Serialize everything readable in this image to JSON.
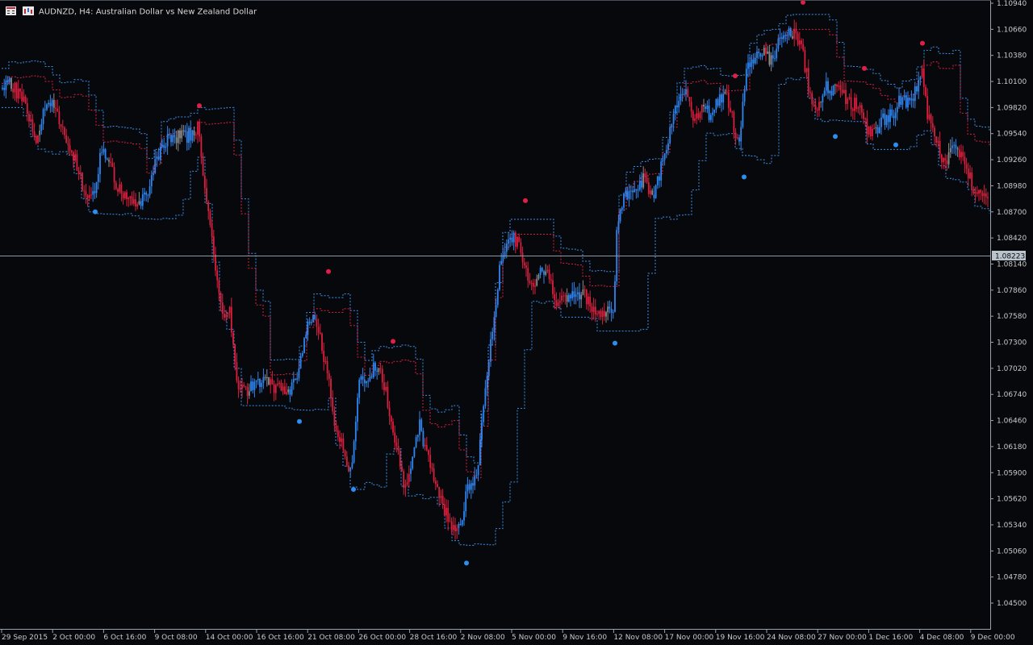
{
  "header": {
    "symbol": "AUDNZD",
    "timeframe": "H4:",
    "description": "Australian Dollar vs New Zealand Dollar"
  },
  "colors": {
    "background": "#07080c",
    "bull": "#2f86f0",
    "bear": "#d8203e",
    "neutral": "#8c8c8c",
    "band_upper": "#3b8fe8",
    "band_lower": "#d8203e",
    "crosshair": "#8a9aa6",
    "price_label_bg": "#b9c3cc"
  },
  "price_marker": "1.08223",
  "chart_data": {
    "type": "candlestick",
    "ylim": [
      1.0437,
      1.1102
    ],
    "y_ticks": [
      "1.10940",
      "1.10660",
      "1.10380",
      "1.10100",
      "1.09820",
      "1.09540",
      "1.09260",
      "1.08980",
      "1.08700",
      "1.08420",
      "1.08140",
      "1.07860",
      "1.07580",
      "1.07300",
      "1.07020",
      "1.06740",
      "1.06460",
      "1.06180",
      "1.05900",
      "1.05620",
      "1.05340",
      "1.05060",
      "1.04780",
      "1.04500"
    ],
    "x_ticks": [
      "29 Sep 2015",
      "2 Oct 00:00",
      "6 Oct 16:00",
      "9 Oct 08:00",
      "14 Oct 00:00",
      "16 Oct 16:00",
      "21 Oct 08:00",
      "26 Oct 00:00",
      "28 Oct 16:00",
      "2 Nov 08:00",
      "5 Nov 00:00",
      "9 Nov 16:00",
      "12 Nov 08:00",
      "17 Nov 00:00",
      "19 Nov 16:00",
      "24 Nov 08:00",
      "27 Nov 00:00",
      "1 Dec 16:00",
      "4 Dec 08:00",
      "9 Dec 00:00"
    ],
    "path": [
      [
        0,
        1.1
      ],
      [
        10,
        1.101
      ],
      [
        30,
        1.099
      ],
      [
        45,
        1.095
      ],
      [
        60,
        1.099
      ],
      [
        75,
        1.0965
      ],
      [
        90,
        1.0935
      ],
      [
        105,
        1.089
      ],
      [
        118,
        1.0885
      ],
      [
        125,
        1.094
      ],
      [
        135,
        1.093
      ],
      [
        145,
        1.0895
      ],
      [
        160,
        1.0885
      ],
      [
        175,
        1.088
      ],
      [
        185,
        1.0895
      ],
      [
        200,
        1.0945
      ],
      [
        215,
        1.095
      ],
      [
        230,
        1.095
      ],
      [
        245,
        1.096
      ],
      [
        255,
        1.089
      ],
      [
        265,
        1.082
      ],
      [
        275,
        1.0765
      ],
      [
        285,
        1.076
      ],
      [
        295,
        1.068
      ],
      [
        310,
        1.068
      ],
      [
        325,
        1.069
      ],
      [
        345,
        1.068
      ],
      [
        360,
        1.0675
      ],
      [
        370,
        1.07
      ],
      [
        385,
        1.076
      ],
      [
        395,
        1.074
      ],
      [
        405,
        1.07
      ],
      [
        415,
        1.064
      ],
      [
        425,
        1.0615
      ],
      [
        435,
        1.059
      ],
      [
        445,
        1.0685
      ],
      [
        455,
        1.069
      ],
      [
        465,
        1.0705
      ],
      [
        475,
        1.069
      ],
      [
        490,
        1.0625
      ],
      [
        500,
        1.058
      ],
      [
        510,
        1.0595
      ],
      [
        520,
        1.064
      ],
      [
        530,
        1.0605
      ],
      [
        540,
        1.058
      ],
      [
        550,
        1.055
      ],
      [
        560,
        1.0535
      ],
      [
        570,
        1.053
      ],
      [
        580,
        1.0575
      ],
      [
        590,
        1.058
      ],
      [
        600,
        1.067
      ],
      [
        610,
        1.074
      ],
      [
        620,
        1.082
      ],
      [
        630,
        1.084
      ],
      [
        640,
        1.084
      ],
      [
        650,
        1.081
      ],
      [
        660,
        1.079
      ],
      [
        670,
        1.081
      ],
      [
        680,
        1.08
      ],
      [
        690,
        1.0775
      ],
      [
        700,
        1.0775
      ],
      [
        710,
        1.078
      ],
      [
        720,
        1.0785
      ],
      [
        730,
        1.0775
      ],
      [
        740,
        1.076
      ],
      [
        750,
        1.076
      ],
      [
        760,
        1.0765
      ],
      [
        765,
        1.086
      ],
      [
        775,
        1.089
      ],
      [
        790,
        1.09
      ],
      [
        800,
        1.0905
      ],
      [
        810,
        1.088
      ],
      [
        820,
        1.0925
      ],
      [
        830,
        1.0955
      ],
      [
        840,
        1.099
      ],
      [
        850,
        1.1005
      ],
      [
        860,
        1.097
      ],
      [
        870,
        1.098
      ],
      [
        880,
        1.0975
      ],
      [
        890,
        1.099
      ],
      [
        900,
        1.0995
      ],
      [
        910,
        1.096
      ],
      [
        915,
        1.094
      ],
      [
        925,
        1.1025
      ],
      [
        935,
        1.1035
      ],
      [
        945,
        1.1045
      ],
      [
        955,
        1.103
      ],
      [
        965,
        1.105
      ],
      [
        975,
        1.106
      ],
      [
        985,
        1.106
      ],
      [
        995,
        1.104
      ],
      [
        1005,
        1.099
      ],
      [
        1015,
        1.0985
      ],
      [
        1025,
        1.1005
      ],
      [
        1035,
        1.1
      ],
      [
        1045,
        1.0995
      ],
      [
        1055,
        1.0985
      ],
      [
        1065,
        1.0985
      ],
      [
        1075,
        1.0955
      ],
      [
        1085,
        1.0955
      ],
      [
        1095,
        1.097
      ],
      [
        1105,
        1.0975
      ],
      [
        1115,
        1.099
      ],
      [
        1125,
        1.0985
      ],
      [
        1135,
        1.1
      ],
      [
        1142,
        1.1025
      ],
      [
        1150,
        1.097
      ],
      [
        1160,
        1.0945
      ],
      [
        1170,
        1.092
      ],
      [
        1180,
        1.094
      ],
      [
        1190,
        1.093
      ],
      [
        1200,
        1.091
      ],
      [
        1210,
        1.089
      ],
      [
        1220,
        1.0895
      ],
      [
        1227,
        1.0885
      ]
    ],
    "markers": [
      {
        "t": "up",
        "x": 118,
        "price": 1.087
      },
      {
        "t": "up",
        "x": 371,
        "price": 1.0645
      },
      {
        "t": "up",
        "x": 438,
        "price": 1.0572
      },
      {
        "t": "up",
        "x": 578,
        "price": 1.0493
      },
      {
        "t": "up",
        "x": 762,
        "price": 1.0729
      },
      {
        "t": "up",
        "x": 922,
        "price": 1.09075
      },
      {
        "t": "up",
        "x": 1035,
        "price": 1.0951
      },
      {
        "t": "up",
        "x": 1110,
        "price": 1.0942
      },
      {
        "t": "down",
        "x": 247,
        "price": 1.0984
      },
      {
        "t": "down",
        "x": 407,
        "price": 1.0806
      },
      {
        "t": "down",
        "x": 487,
        "price": 1.0731
      },
      {
        "t": "down",
        "x": 651,
        "price": 1.0882
      },
      {
        "t": "down",
        "x": 911,
        "price": 1.1016
      },
      {
        "t": "down",
        "x": 995,
        "price": 1.1095
      },
      {
        "t": "down",
        "x": 1071,
        "price": 1.1024
      },
      {
        "t": "down",
        "x": 1143,
        "price": 1.1051
      }
    ]
  }
}
